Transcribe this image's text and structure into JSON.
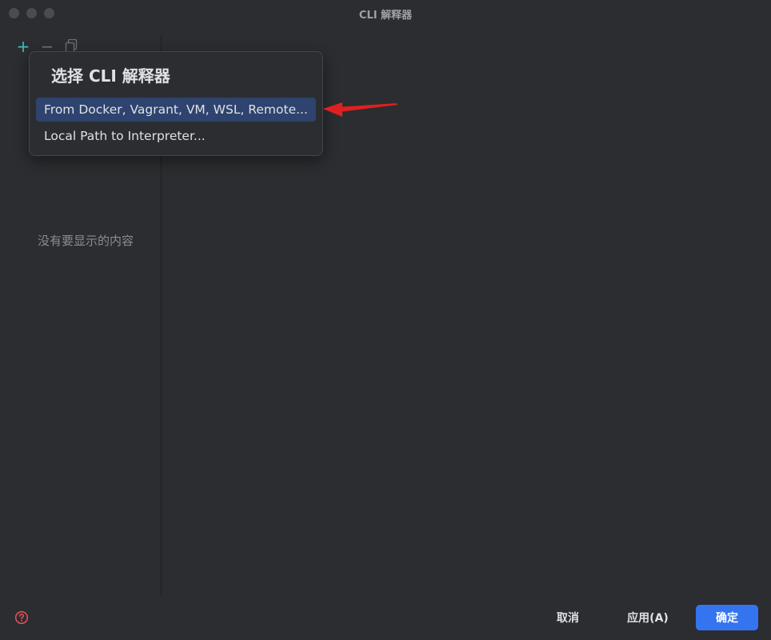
{
  "window": {
    "title": "CLI 解释器"
  },
  "toolbar": {
    "add_icon": "plus-icon",
    "remove_icon": "minus-icon",
    "copy_icon": "copy-icon",
    "add_label": "+",
    "remove_label": "−"
  },
  "list": {
    "empty_text": "没有要显示的内容"
  },
  "popup": {
    "title": "选择 CLI 解释器",
    "items": [
      {
        "label": "From Docker, Vagrant, VM, WSL, Remote...",
        "selected": true
      },
      {
        "label": "Local Path to Interpreter...",
        "selected": false
      }
    ]
  },
  "footer": {
    "help_icon": "help-icon",
    "cancel_label": "取消",
    "apply_label": "应用(A)",
    "ok_label": "确定"
  },
  "colors": {
    "background": "#2b2d30",
    "selection": "#2e436e",
    "primary_button": "#3574f0",
    "annotation_arrow": "#e02020",
    "help_icon": "#e0505a"
  }
}
